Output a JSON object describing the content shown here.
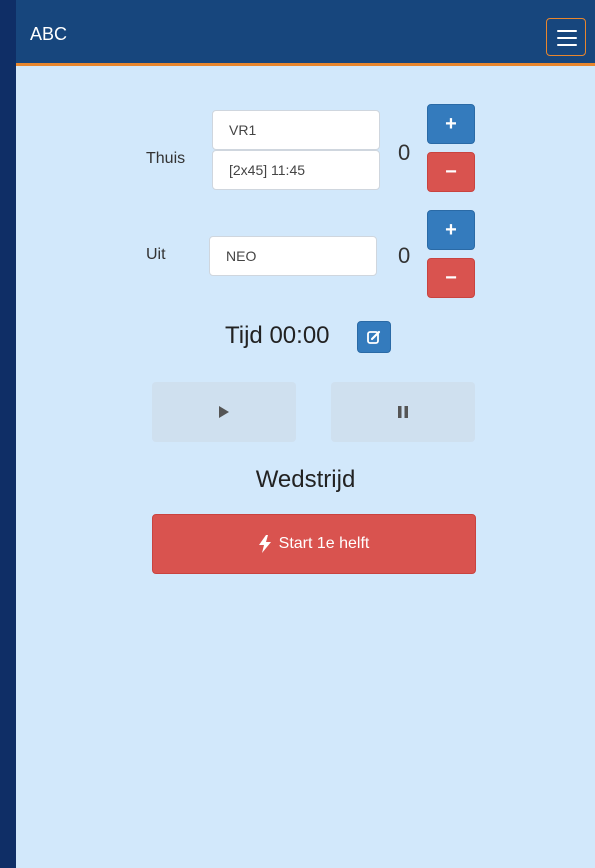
{
  "navbar": {
    "brand": "ABC",
    "menu_icon": "hamburger-icon"
  },
  "home": {
    "label": "Thuis",
    "team": "VR1",
    "match_info": "[2x45] 11:45",
    "score": "0"
  },
  "away": {
    "label": "Uit",
    "team": "NEO",
    "score": "0"
  },
  "buttons": {
    "plus": "+",
    "minus": "−"
  },
  "timer": {
    "text": "Tijd 00:00",
    "edit_icon": "edit-icon"
  },
  "controls": {
    "play_icon": "play-icon",
    "pause_icon": "pause-icon"
  },
  "match": {
    "title": "Wedstrijd",
    "start_label": "Start 1e helft",
    "start_icon": "bolt-icon"
  },
  "colors": {
    "navbar": "#17467d",
    "accent": "#e8862d",
    "background": "#d2e8fb",
    "primary": "#347bbd",
    "danger": "#d9534f"
  }
}
